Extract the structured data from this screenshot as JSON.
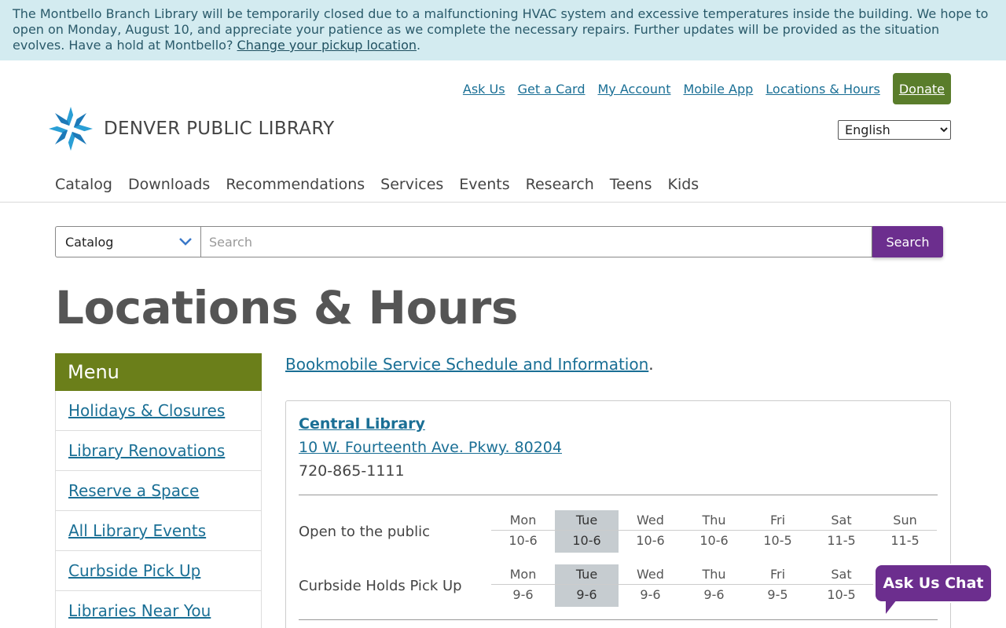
{
  "alert": {
    "text": "The Montbello Branch Library will be temporarily closed due to a malfunctioning HVAC system and excessive temperatures inside the building. We hope to open on Monday, August 10, and appreciate your patience as we complete the necessary repairs. Further updates will be provided as the situation evolves. Have a hold at Montbello? ",
    "link": "Change your pickup location",
    "end": "."
  },
  "utility": {
    "ask_us": "Ask Us",
    "get_card": "Get a Card",
    "my_account": "My Account",
    "mobile_app": "Mobile App",
    "locations": "Locations & Hours",
    "donate": "Donate"
  },
  "language": {
    "selected": "English"
  },
  "logo": {
    "text": "DENVER PUBLIC LIBRARY",
    "icon": "dpl-star-logo-icon"
  },
  "mainnav": [
    "Catalog",
    "Downloads",
    "Recommendations",
    "Services",
    "Events",
    "Research",
    "Teens",
    "Kids"
  ],
  "search": {
    "scope": "Catalog",
    "placeholder": "Search",
    "button": "Search"
  },
  "page_title": "Locations & Hours",
  "menu": {
    "title": "Menu",
    "items": [
      "Holidays & Closures",
      "Library Renovations",
      "Reserve a Space",
      "All Library Events",
      "Curbside Pick Up",
      "Libraries Near You"
    ]
  },
  "bookmobile": {
    "link": "Bookmobile Service Schedule and Information",
    "end": "."
  },
  "location": {
    "name": "Central Library",
    "address": "10 W. Fourteenth Ave. Pkwy. 80204",
    "phone": "720-865-1111",
    "schedules": [
      {
        "label": "Open to the public",
        "days": [
          "Mon",
          "Tue",
          "Wed",
          "Thu",
          "Fri",
          "Sat",
          "Sun"
        ],
        "hours": [
          "10-6",
          "10-6",
          "10-6",
          "10-6",
          "10-5",
          "11-5",
          "11-5"
        ]
      },
      {
        "label": "Curbside Holds Pick Up",
        "days": [
          "Mon",
          "Tue",
          "Wed",
          "Thu",
          "Fri",
          "Sat"
        ],
        "hours": [
          "9-6",
          "9-6",
          "9-6",
          "9-6",
          "9-5",
          "10-5"
        ]
      }
    ],
    "today": "Tue"
  },
  "chat": {
    "label": "Ask Us Chat"
  },
  "colors": {
    "alert_bg": "#d3ebf0",
    "link": "#1a6f95",
    "donate": "#5a7d2b",
    "menu_head": "#6b7f1a",
    "search_btn": "#6c2e8e",
    "today_bg": "#c6ccd0"
  }
}
